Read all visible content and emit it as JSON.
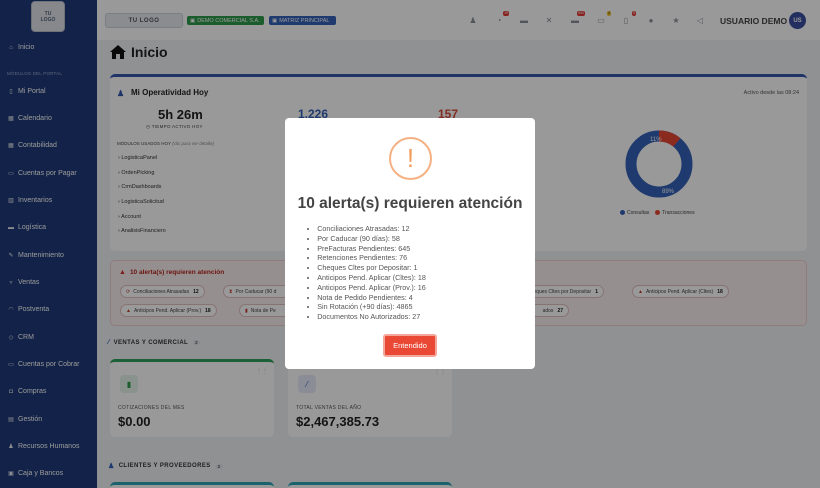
{
  "sidebar": {
    "logo_line1": "TU",
    "logo_line2": "LOGO",
    "section_label": "MÓDULOS DEL PORTAL",
    "items": [
      {
        "label": "Inicio"
      },
      {
        "label": "Mi Portal"
      },
      {
        "label": "Calendario"
      },
      {
        "label": "Contabilidad"
      },
      {
        "label": "Cuentas por Pagar"
      },
      {
        "label": "Inventarios"
      },
      {
        "label": "Logística"
      },
      {
        "label": "Mantenimiento"
      },
      {
        "label": "Ventas"
      },
      {
        "label": "Postventa"
      },
      {
        "label": "CRM"
      },
      {
        "label": "Cuentas por Cobrar"
      },
      {
        "label": "Compras"
      },
      {
        "label": "Gestión"
      },
      {
        "label": "Recursos Humanos"
      },
      {
        "label": "Caja y Bancos"
      }
    ]
  },
  "topbar": {
    "logo_text": "TU LOGO",
    "company_pill": "DEMO COMERCIAL S.A.",
    "branch_pill": "MATRIZ PRINCIPAL",
    "icons": [
      {
        "name": "users-icon",
        "badge": ""
      },
      {
        "name": "bell-icon",
        "badge": "19"
      },
      {
        "name": "chat-icon",
        "badge": ""
      },
      {
        "name": "tools-icon",
        "badge": ""
      },
      {
        "name": "truck-icon",
        "badge": "900"
      },
      {
        "name": "folder-icon",
        "badge": "4"
      },
      {
        "name": "file-icon",
        "badge": "5"
      },
      {
        "name": "globe-icon",
        "badge": ""
      },
      {
        "name": "star-icon",
        "badge": ""
      },
      {
        "name": "megaphone-icon",
        "badge": ""
      }
    ],
    "user_name": "USUARIO DEMO",
    "avatar_initials": "US"
  },
  "page": {
    "title": "Inicio"
  },
  "operatividad": {
    "title": "Mi Operatividad Hoy",
    "since": "Activo desde las 08:24",
    "time": "5h 26m",
    "time_label": "TIEMPO ACTIVO HOY",
    "stat_blue": "1,226",
    "stat_red": "157",
    "modules_label": "MÓDULOS USADOS HOY",
    "modules_hint": "(clic para ver detalle)",
    "modules": [
      "LogisticaPanel",
      "OrdenPicking",
      "CrmDashboards",
      "LogisticaSolicitud",
      "Account",
      "AnalisisFinanciero"
    ],
    "donut": {
      "consultas_pct": 89,
      "transacciones_pct": 11,
      "label_small": "11%",
      "label_big": "89%"
    },
    "legend": [
      {
        "label": "Consultas",
        "color": "#3561b8"
      },
      {
        "label": "Transacciones",
        "color": "#e84834"
      }
    ]
  },
  "alerts_card": {
    "title": "10 alerta(s) requieren atención",
    "chips": [
      {
        "label": "Conciliaciones Atrasadas",
        "count": "12"
      },
      {
        "label": "Por Caducar (90 d",
        "count": ""
      },
      {
        "label": "Cheques Cltes por Depositar",
        "count": "1"
      },
      {
        "label": "Anticipos Pend. Aplicar (Cltes)",
        "count": "18"
      },
      {
        "label": "Anticipos Pend. Aplicar (Prov.)",
        "count": "18"
      },
      {
        "label": "Nota de Pe",
        "count": ""
      },
      {
        "label": "ados",
        "count": "27"
      }
    ]
  },
  "sections": {
    "ventas": {
      "title": "VENTAS Y COMERCIAL",
      "count": "2"
    },
    "clientes": {
      "title": "CLIENTES Y PROVEEDORES",
      "count": "2"
    }
  },
  "kpis": [
    {
      "label": "COTIZACIONES DEL MES",
      "value": "$0.00",
      "icon": "file-icon"
    },
    {
      "label": "TOTAL VENTAS DEL AÑO",
      "value": "$2,467,385.73",
      "icon": "chart-icon"
    }
  ],
  "modal": {
    "title": "10 alerta(s) requieren atención",
    "items": [
      "Conciliaciones Atrasadas: 12",
      "Por Caducar (90 días): 58",
      "PreFacturas Pendientes: 645",
      "Retenciones Pendientes: 76",
      "Cheques Cltes por Depositar: 1",
      "Anticipos Pend. Aplicar (Cltes): 18",
      "Anticipos Pend. Aplicar (Prov.): 16",
      "Nota de Pedido Pendientes: 4",
      "Sin Rotación (+90 días): 4865",
      "Documentos No Autorizados: 27"
    ],
    "button_label": "Entendido"
  }
}
